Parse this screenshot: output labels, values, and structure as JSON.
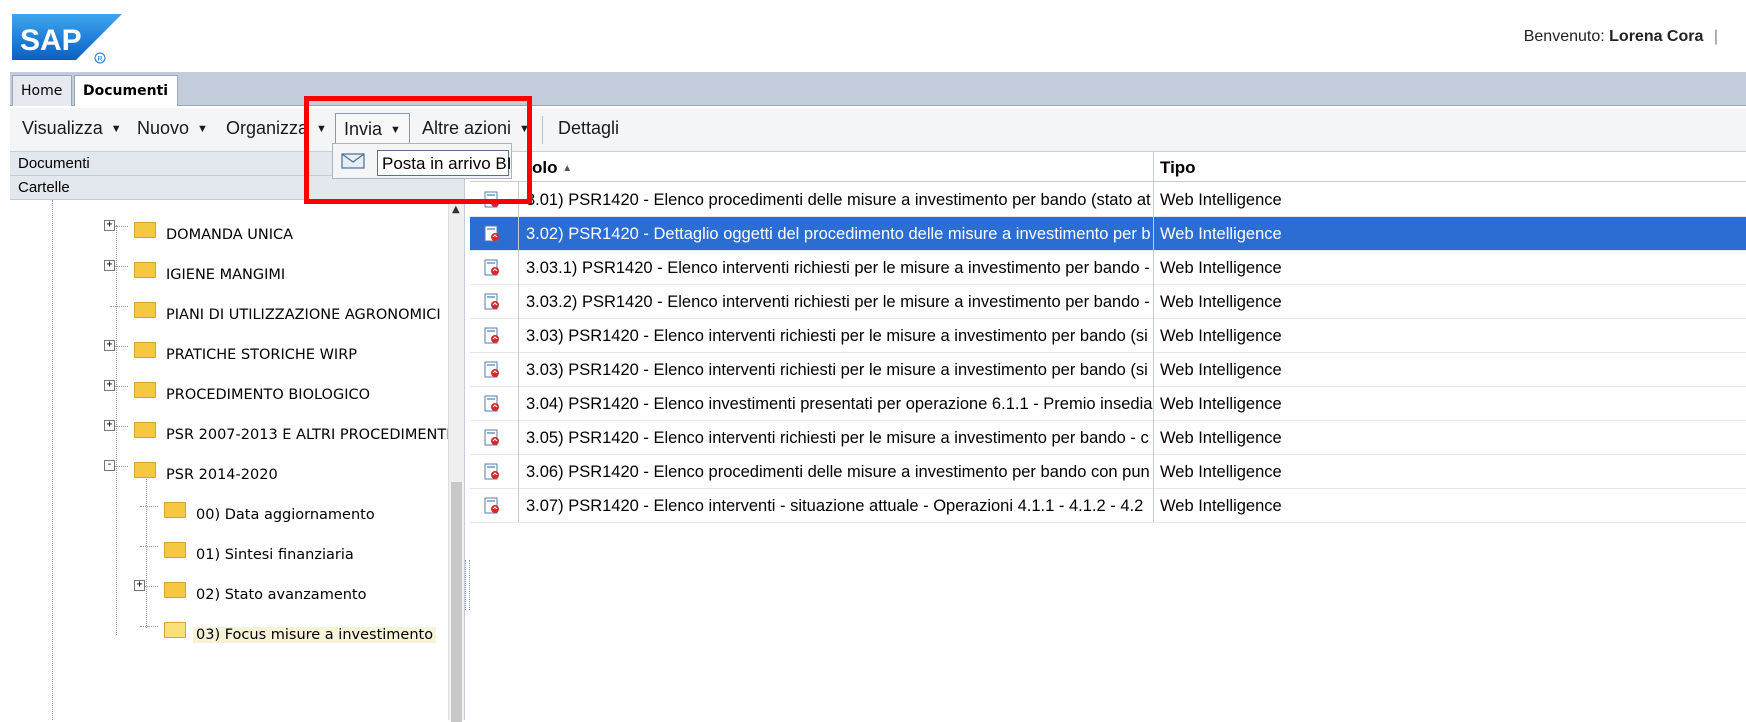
{
  "brand": {
    "logo_text": "SAP"
  },
  "header": {
    "welcome_label": "Benvenuto:",
    "user_name": "Lorena Cora",
    "separator": "|"
  },
  "tabs": [
    {
      "label": "Home"
    },
    {
      "label": "Documenti"
    }
  ],
  "toolbar": {
    "visualizza": "Visualizza",
    "nuovo": "Nuovo",
    "organizza": "Organizza",
    "invia": "Invia",
    "altre_azioni": "Altre azioni",
    "dettagli": "Dettagli"
  },
  "send_menu": {
    "item": "Posta in arrivo BI"
  },
  "left_panel": {
    "title": "Documenti",
    "section": "Cartelle"
  },
  "tree": [
    {
      "label": "DOMANDA UNICA",
      "expander": "+"
    },
    {
      "label": "IGIENE MANGIMI",
      "expander": "+"
    },
    {
      "label": "PIANI DI UTILIZZAZIONE AGRONOMICI",
      "expander": ""
    },
    {
      "label": "PRATICHE STORICHE WIRP",
      "expander": "+"
    },
    {
      "label": "PROCEDIMENTO BIOLOGICO",
      "expander": "+"
    },
    {
      "label": "PSR 2007-2013 E ALTRI PROCEDIMENTI",
      "expander": "+"
    },
    {
      "label": "PSR 2014-2020",
      "expander": "-"
    },
    {
      "label": "00) Data aggiornamento",
      "expander": ""
    },
    {
      "label": "01) Sintesi finanziaria",
      "expander": ""
    },
    {
      "label": "02) Stato avanzamento",
      "expander": "+"
    },
    {
      "label": "03) Focus misure a investimento",
      "expander": "",
      "selected": true
    }
  ],
  "grid": {
    "col_title": "olo",
    "col_sort": "▲",
    "col_type": "Tipo",
    "rows": [
      {
        "title": "3.01) PSR1420 - Elenco procedimenti delle misure a investimento per bando (stato at",
        "type": "Web Intelligence"
      },
      {
        "title": "3.02) PSR1420 - Dettaglio oggetti del procedimento delle misure a investimento per b",
        "type": "Web Intelligence",
        "selected": true
      },
      {
        "title": "3.03.1) PSR1420 - Elenco interventi richiesti per le misure a investimento per bando -",
        "type": "Web Intelligence"
      },
      {
        "title": "3.03.2) PSR1420 - Elenco interventi richiesti per le misure a investimento per bando -",
        "type": "Web Intelligence"
      },
      {
        "title": "3.03) PSR1420 - Elenco interventi richiesti per le misure a investimento per bando (si",
        "type": "Web Intelligence"
      },
      {
        "title": "3.03) PSR1420 - Elenco interventi richiesti per le misure a investimento per bando (si",
        "type": "Web Intelligence"
      },
      {
        "title": "3.04) PSR1420 - Elenco investimenti presentati per operazione 6.1.1 - Premio insedia",
        "type": "Web Intelligence"
      },
      {
        "title": "3.05) PSR1420 - Elenco interventi richiesti per le misure a investimento per bando - c",
        "type": "Web Intelligence"
      },
      {
        "title": "3.06) PSR1420 - Elenco procedimenti delle misure a investimento per bando con pun",
        "type": "Web Intelligence"
      },
      {
        "title": "3.07) PSR1420 - Elenco interventi - situazione attuale - Operazioni 4.1.1 - 4.1.2 - 4.2",
        "type": "Web Intelligence"
      }
    ]
  },
  "colors": {
    "selection": "#2b6dd2",
    "highlight_box": "#ff0000",
    "brand_blue": "#1a73d8"
  }
}
